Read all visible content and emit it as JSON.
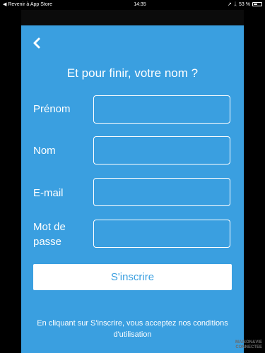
{
  "status_bar": {
    "back_link": "◀ Revenir à App Store",
    "time": "14:35",
    "battery": "53 %",
    "battery_level": 0.53
  },
  "form": {
    "title": "Et pour finir, votre nom ?",
    "fields": [
      {
        "label": "Prénom",
        "value": ""
      },
      {
        "label": "Nom",
        "value": ""
      },
      {
        "label": "E-mail",
        "value": ""
      },
      {
        "label": "Mot de passe",
        "value": ""
      }
    ],
    "submit_label": "S'inscrire",
    "terms_text": "En cliquant sur S'inscrire, vous acceptez nos conditions d'utilisation"
  },
  "watermark": {
    "line1": "MAISON&VIE",
    "line2": "CONNECTEE"
  },
  "colors": {
    "accent": "#3a9fe0",
    "background": "#000000"
  }
}
